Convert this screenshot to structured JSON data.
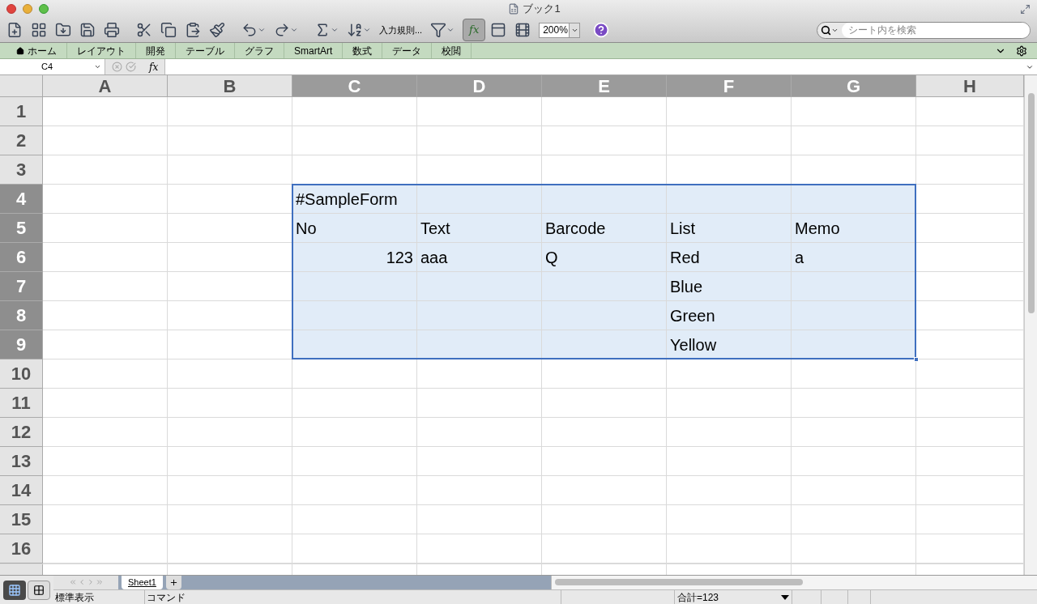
{
  "window": {
    "title": "ブック1"
  },
  "toolbar": {
    "input_rules_label": "入力規則...",
    "formula_toggle": {
      "label": "fx",
      "selected": true
    },
    "zoom": "200%"
  },
  "search": {
    "placeholder": "シート内を検索"
  },
  "ribbon_tabs": [
    {
      "label": "ホーム",
      "kind": "home"
    },
    {
      "label": "レイアウト",
      "kind": "text"
    },
    {
      "label": "開発",
      "kind": "text"
    },
    {
      "label": "テーブル",
      "kind": "text"
    },
    {
      "label": "グラフ",
      "kind": "text"
    },
    {
      "label": "SmartArt",
      "kind": "text"
    },
    {
      "label": "数式",
      "kind": "text"
    },
    {
      "label": "データ",
      "kind": "text"
    },
    {
      "label": "校閲",
      "kind": "text"
    }
  ],
  "formula_bar": {
    "name_box": "C4",
    "fx_label": "fx"
  },
  "columns": [
    {
      "label": "A",
      "selected": false
    },
    {
      "label": "B",
      "selected": false
    },
    {
      "label": "C",
      "selected": true
    },
    {
      "label": "D",
      "selected": true
    },
    {
      "label": "E",
      "selected": true
    },
    {
      "label": "F",
      "selected": true
    },
    {
      "label": "G",
      "selected": true
    },
    {
      "label": "H",
      "selected": false
    }
  ],
  "rows": [
    {
      "label": "1",
      "selected": false,
      "cells": []
    },
    {
      "label": "2",
      "selected": false,
      "cells": []
    },
    {
      "label": "3",
      "selected": false,
      "cells": []
    },
    {
      "label": "4",
      "selected": true,
      "cells": {
        "C": {
          "text": "#SampleForm",
          "kind": "text"
        }
      }
    },
    {
      "label": "5",
      "selected": true,
      "cells": {
        "C": {
          "text": "No",
          "kind": "text"
        },
        "D": {
          "text": "Text",
          "kind": "text"
        },
        "E": {
          "text": "Barcode",
          "kind": "text"
        },
        "F": {
          "text": "List",
          "kind": "text"
        },
        "G": {
          "text": "Memo",
          "kind": "text"
        }
      }
    },
    {
      "label": "6",
      "selected": true,
      "cells": {
        "C": {
          "text": "123",
          "kind": "number"
        },
        "D": {
          "text": "aaa",
          "kind": "text"
        },
        "E": {
          "text": "Q",
          "kind": "text"
        },
        "F": {
          "text": "Red",
          "kind": "text"
        },
        "G": {
          "text": "a",
          "kind": "text"
        }
      }
    },
    {
      "label": "7",
      "selected": true,
      "cells": {
        "F": {
          "text": "Blue",
          "kind": "text"
        }
      }
    },
    {
      "label": "8",
      "selected": true,
      "cells": {
        "F": {
          "text": "Green",
          "kind": "text"
        }
      }
    },
    {
      "label": "9",
      "selected": true,
      "cells": {
        "F": {
          "text": "Yellow",
          "kind": "text"
        }
      }
    },
    {
      "label": "10",
      "selected": false,
      "cells": []
    },
    {
      "label": "11",
      "selected": false,
      "cells": []
    },
    {
      "label": "12",
      "selected": false,
      "cells": []
    },
    {
      "label": "13",
      "selected": false,
      "cells": []
    },
    {
      "label": "14",
      "selected": false,
      "cells": []
    },
    {
      "label": "15",
      "selected": false,
      "cells": []
    },
    {
      "label": "16",
      "selected": false,
      "cells": []
    }
  ],
  "sheet_tabs": [
    {
      "label": "Sheet1",
      "selected": true
    }
  ],
  "status_bar": {
    "view": "標準表示",
    "mode": "コマンド",
    "sum": "合計=123"
  }
}
